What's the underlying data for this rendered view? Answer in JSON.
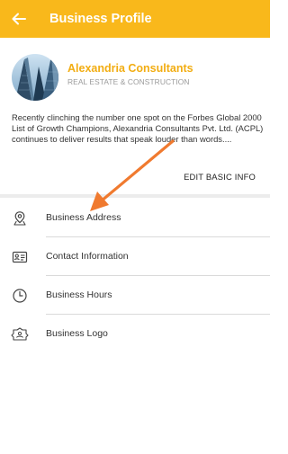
{
  "header": {
    "title": "Business Profile",
    "back_icon": "arrow-left-icon",
    "background_color": "#f9b81b"
  },
  "profile": {
    "name": "Alexandria Consultants",
    "category": "REAL ESTATE & CONSTRUCTION",
    "description": "Recently clinching the number one spot on the Forbes Global 2000 List of Growth Champions, Alexandria Consultants Pvt. Ltd. (ACPL) continues to deliver results that speak louder than words....",
    "edit_label": "EDIT BASIC INFO",
    "name_color": "#f2ad12"
  },
  "menu": {
    "items": [
      {
        "label": "Business Address",
        "icon": "map-pin-icon"
      },
      {
        "label": "Contact Information",
        "icon": "contact-card-icon"
      },
      {
        "label": "Business Hours",
        "icon": "clock-icon"
      },
      {
        "label": "Business Logo",
        "icon": "logo-badge-icon"
      }
    ]
  },
  "annotation": {
    "arrow_color": "#f07a2f"
  }
}
